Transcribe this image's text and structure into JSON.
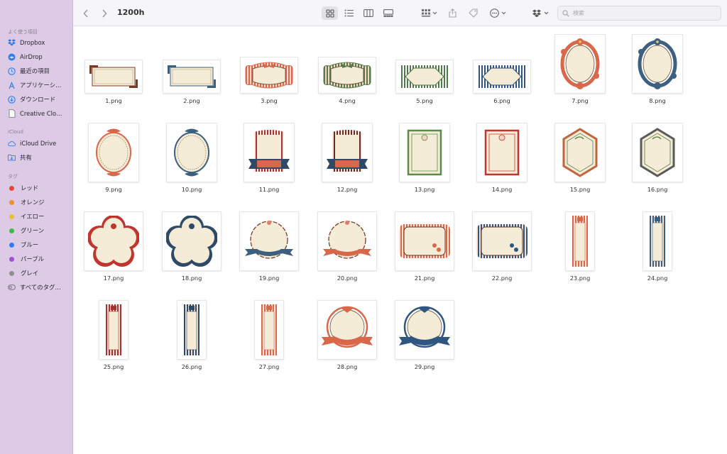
{
  "window": {
    "title": "1200h"
  },
  "toolbar": {
    "back_icon": "chevron-left-icon",
    "forward_icon": "chevron-right-icon",
    "search_placeholder": "検索"
  },
  "sidebar": {
    "favorites_label": "よく使う項目",
    "favorites": [
      {
        "label": "Dropbox",
        "icon": "dropbox-icon"
      },
      {
        "label": "AirDrop",
        "icon": "airdrop-icon"
      },
      {
        "label": "最近の項目",
        "icon": "clock-icon"
      },
      {
        "label": "アプリケーシ…",
        "icon": "applications-icon"
      },
      {
        "label": "ダウンロード",
        "icon": "download-icon"
      },
      {
        "label": "Creative Clo…",
        "icon": "document-icon"
      }
    ],
    "icloud_label": "iCloud",
    "icloud": [
      {
        "label": "iCloud Drive",
        "icon": "cloud-icon"
      },
      {
        "label": "共有",
        "icon": "shared-folder-icon"
      }
    ],
    "tags_label": "タグ",
    "tags": [
      {
        "label": "レッド",
        "color": "#e8443a"
      },
      {
        "label": "オレンジ",
        "color": "#f0902a"
      },
      {
        "label": "イエロー",
        "color": "#e9c22c"
      },
      {
        "label": "グリーン",
        "color": "#3fb74a"
      },
      {
        "label": "ブルー",
        "color": "#2e7cf6"
      },
      {
        "label": "パープル",
        "color": "#a150d6"
      },
      {
        "label": "グレイ",
        "color": "#8e8e93"
      },
      {
        "label": "すべてのタグ…",
        "color": ""
      }
    ]
  },
  "files": [
    {
      "name": "1.png",
      "shape": "rect-corner",
      "accent": "#7a3a2a"
    },
    {
      "name": "2.png",
      "shape": "rect-corner",
      "accent": "#3d5f80"
    },
    {
      "name": "3.png",
      "shape": "bow",
      "accent": "#d9674a"
    },
    {
      "name": "4.png",
      "shape": "bow",
      "accent": "#5b7a4a"
    },
    {
      "name": "5.png",
      "shape": "diamond",
      "accent": "#4f7a4a"
    },
    {
      "name": "6.png",
      "shape": "diamond",
      "accent": "#2e5680"
    },
    {
      "name": "7.png",
      "shape": "oval-floral",
      "accent": "#d9674a"
    },
    {
      "name": "8.png",
      "shape": "oval-floral",
      "accent": "#3d5f80"
    },
    {
      "name": "9.png",
      "shape": "oval",
      "accent": "#d9674a"
    },
    {
      "name": "10.png",
      "shape": "oval",
      "accent": "#3d5f80"
    },
    {
      "name": "11.png",
      "shape": "banner",
      "accent": "#a83232"
    },
    {
      "name": "12.png",
      "shape": "banner",
      "accent": "#6e2a22"
    },
    {
      "name": "13.png",
      "shape": "card",
      "accent": "#5b8a4a"
    },
    {
      "name": "14.png",
      "shape": "card",
      "accent": "#c0362f"
    },
    {
      "name": "15.png",
      "shape": "octagon",
      "accent": "#c2643c"
    },
    {
      "name": "16.png",
      "shape": "octagon",
      "accent": "#5a5a5a"
    },
    {
      "name": "17.png",
      "shape": "flower",
      "accent": "#c0362f"
    },
    {
      "name": "18.png",
      "shape": "flower",
      "accent": "#2e4a66"
    },
    {
      "name": "19.png",
      "shape": "scallop-ribbon",
      "accent": "#3d5f80"
    },
    {
      "name": "20.png",
      "shape": "scallop-ribbon",
      "accent": "#d9674a"
    },
    {
      "name": "21.png",
      "shape": "wide-frame",
      "accent": "#d9674a"
    },
    {
      "name": "22.png",
      "shape": "wide-frame",
      "accent": "#2e5680"
    },
    {
      "name": "23.png",
      "shape": "tall",
      "accent": "#d9674a"
    },
    {
      "name": "24.png",
      "shape": "tall",
      "accent": "#3d5f80"
    },
    {
      "name": "25.png",
      "shape": "tall",
      "accent": "#a83232"
    },
    {
      "name": "26.png",
      "shape": "tall",
      "accent": "#2e4a66"
    },
    {
      "name": "27.png",
      "shape": "tall",
      "accent": "#d9674a"
    },
    {
      "name": "28.png",
      "shape": "crest-ribbon",
      "accent": "#d9674a"
    },
    {
      "name": "29.png",
      "shape": "crest-ribbon",
      "accent": "#2e5680"
    }
  ]
}
